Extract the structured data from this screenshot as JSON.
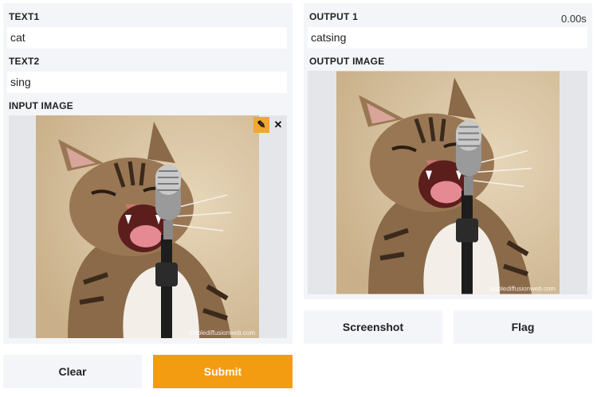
{
  "inputs": {
    "text1": {
      "label": "TEXT1",
      "value": "cat"
    },
    "text2": {
      "label": "TEXT2",
      "value": "sing"
    },
    "image": {
      "label": "INPUT IMAGE",
      "watermark": "stablediffusionweb.com"
    }
  },
  "outputs": {
    "output1": {
      "label": "OUTPUT 1",
      "value": "catsing",
      "timer": "0.00s"
    },
    "image": {
      "label": "OUTPUT IMAGE"
    }
  },
  "buttons": {
    "clear": "Clear",
    "submit": "Submit",
    "screenshot": "Screenshot",
    "flag": "Flag"
  },
  "icons": {
    "edit": "pencil-icon",
    "close": "close-icon"
  },
  "colors": {
    "primary": "#f39c12",
    "edit_badge": "#f1a731"
  }
}
